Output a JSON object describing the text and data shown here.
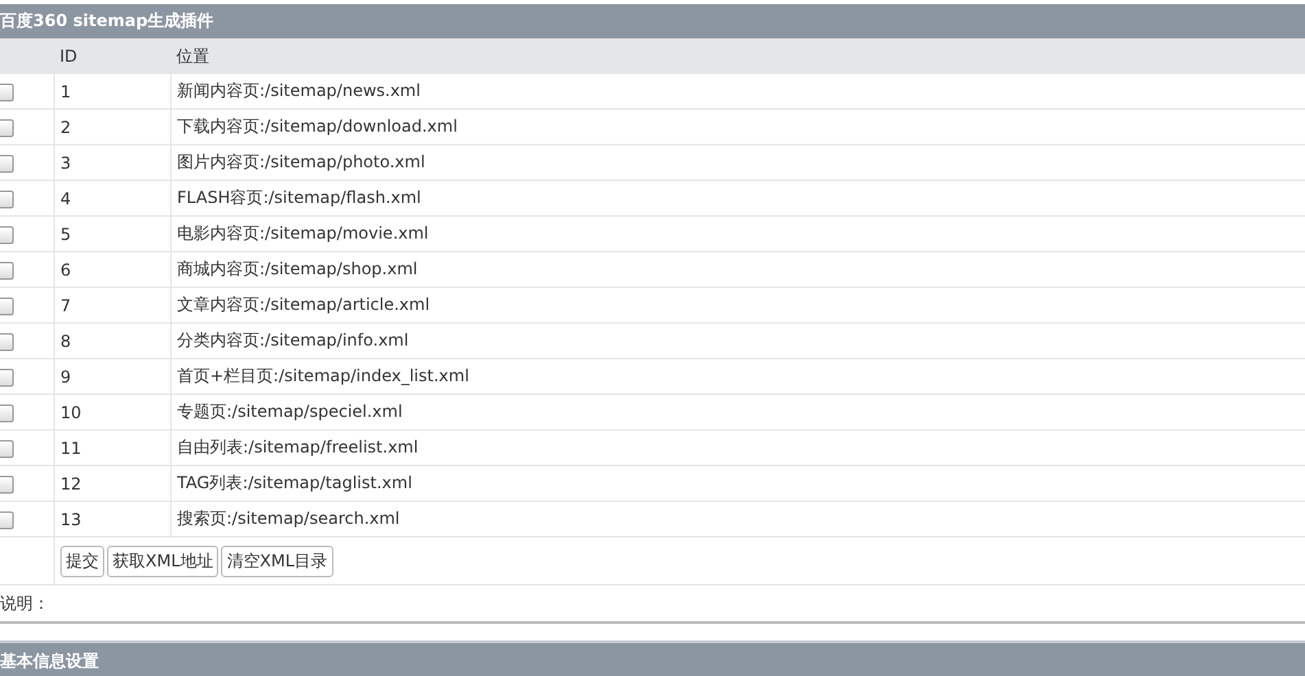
{
  "panel": {
    "title": "百度360 sitemap生成插件"
  },
  "table": {
    "columns": [
      "ID",
      "位置"
    ],
    "rows": [
      {
        "id": "1",
        "location": "新闻内容页:/sitemap/news.xml",
        "checked": false
      },
      {
        "id": "2",
        "location": "下载内容页:/sitemap/download.xml",
        "checked": false
      },
      {
        "id": "3",
        "location": "图片内容页:/sitemap/photo.xml",
        "checked": false
      },
      {
        "id": "4",
        "location": "FLASH容页:/sitemap/flash.xml",
        "checked": false
      },
      {
        "id": "5",
        "location": "电影内容页:/sitemap/movie.xml",
        "checked": false
      },
      {
        "id": "6",
        "location": "商城内容页:/sitemap/shop.xml",
        "checked": false
      },
      {
        "id": "7",
        "location": "文章内容页:/sitemap/article.xml",
        "checked": false
      },
      {
        "id": "8",
        "location": "分类内容页:/sitemap/info.xml",
        "checked": false
      },
      {
        "id": "9",
        "location": "首页+栏目页:/sitemap/index_list.xml",
        "checked": false
      },
      {
        "id": "10",
        "location": "专题页:/sitemap/speciel.xml",
        "checked": false
      },
      {
        "id": "11",
        "location": "自由列表:/sitemap/freelist.xml",
        "checked": false
      },
      {
        "id": "12",
        "location": "TAG列表:/sitemap/taglist.xml",
        "checked": false
      },
      {
        "id": "13",
        "location": "搜索页:/sitemap/search.xml",
        "checked": false
      }
    ]
  },
  "buttons": [
    "提交",
    "获取XML地址",
    "清空XML目录"
  ],
  "note": "说明：",
  "next_panel": {
    "title": "基本信息设置"
  }
}
